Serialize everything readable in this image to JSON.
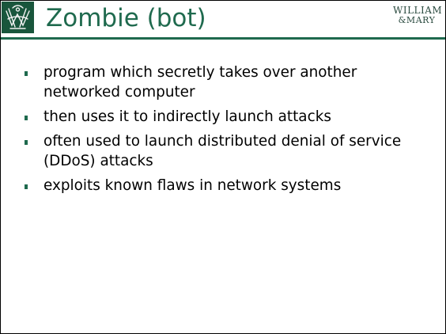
{
  "slide": {
    "title": "Zombie (bot)",
    "logo_text": {
      "line1": "WILLIAM",
      "line2": "&MARY"
    },
    "bullets": [
      "program which secretly takes over another networked computer",
      "then uses it to indirectly launch attacks",
      "often used to launch distributed denial of service (DDoS) attacks",
      "exploits known flaws in network systems"
    ]
  },
  "icons": {
    "crest": "cypher-crest-icon"
  },
  "colors": {
    "accent_green": "#1f6a4e",
    "crest_bg": "#19563c",
    "text": "#000000",
    "wordmark": "#2a4a3f"
  }
}
